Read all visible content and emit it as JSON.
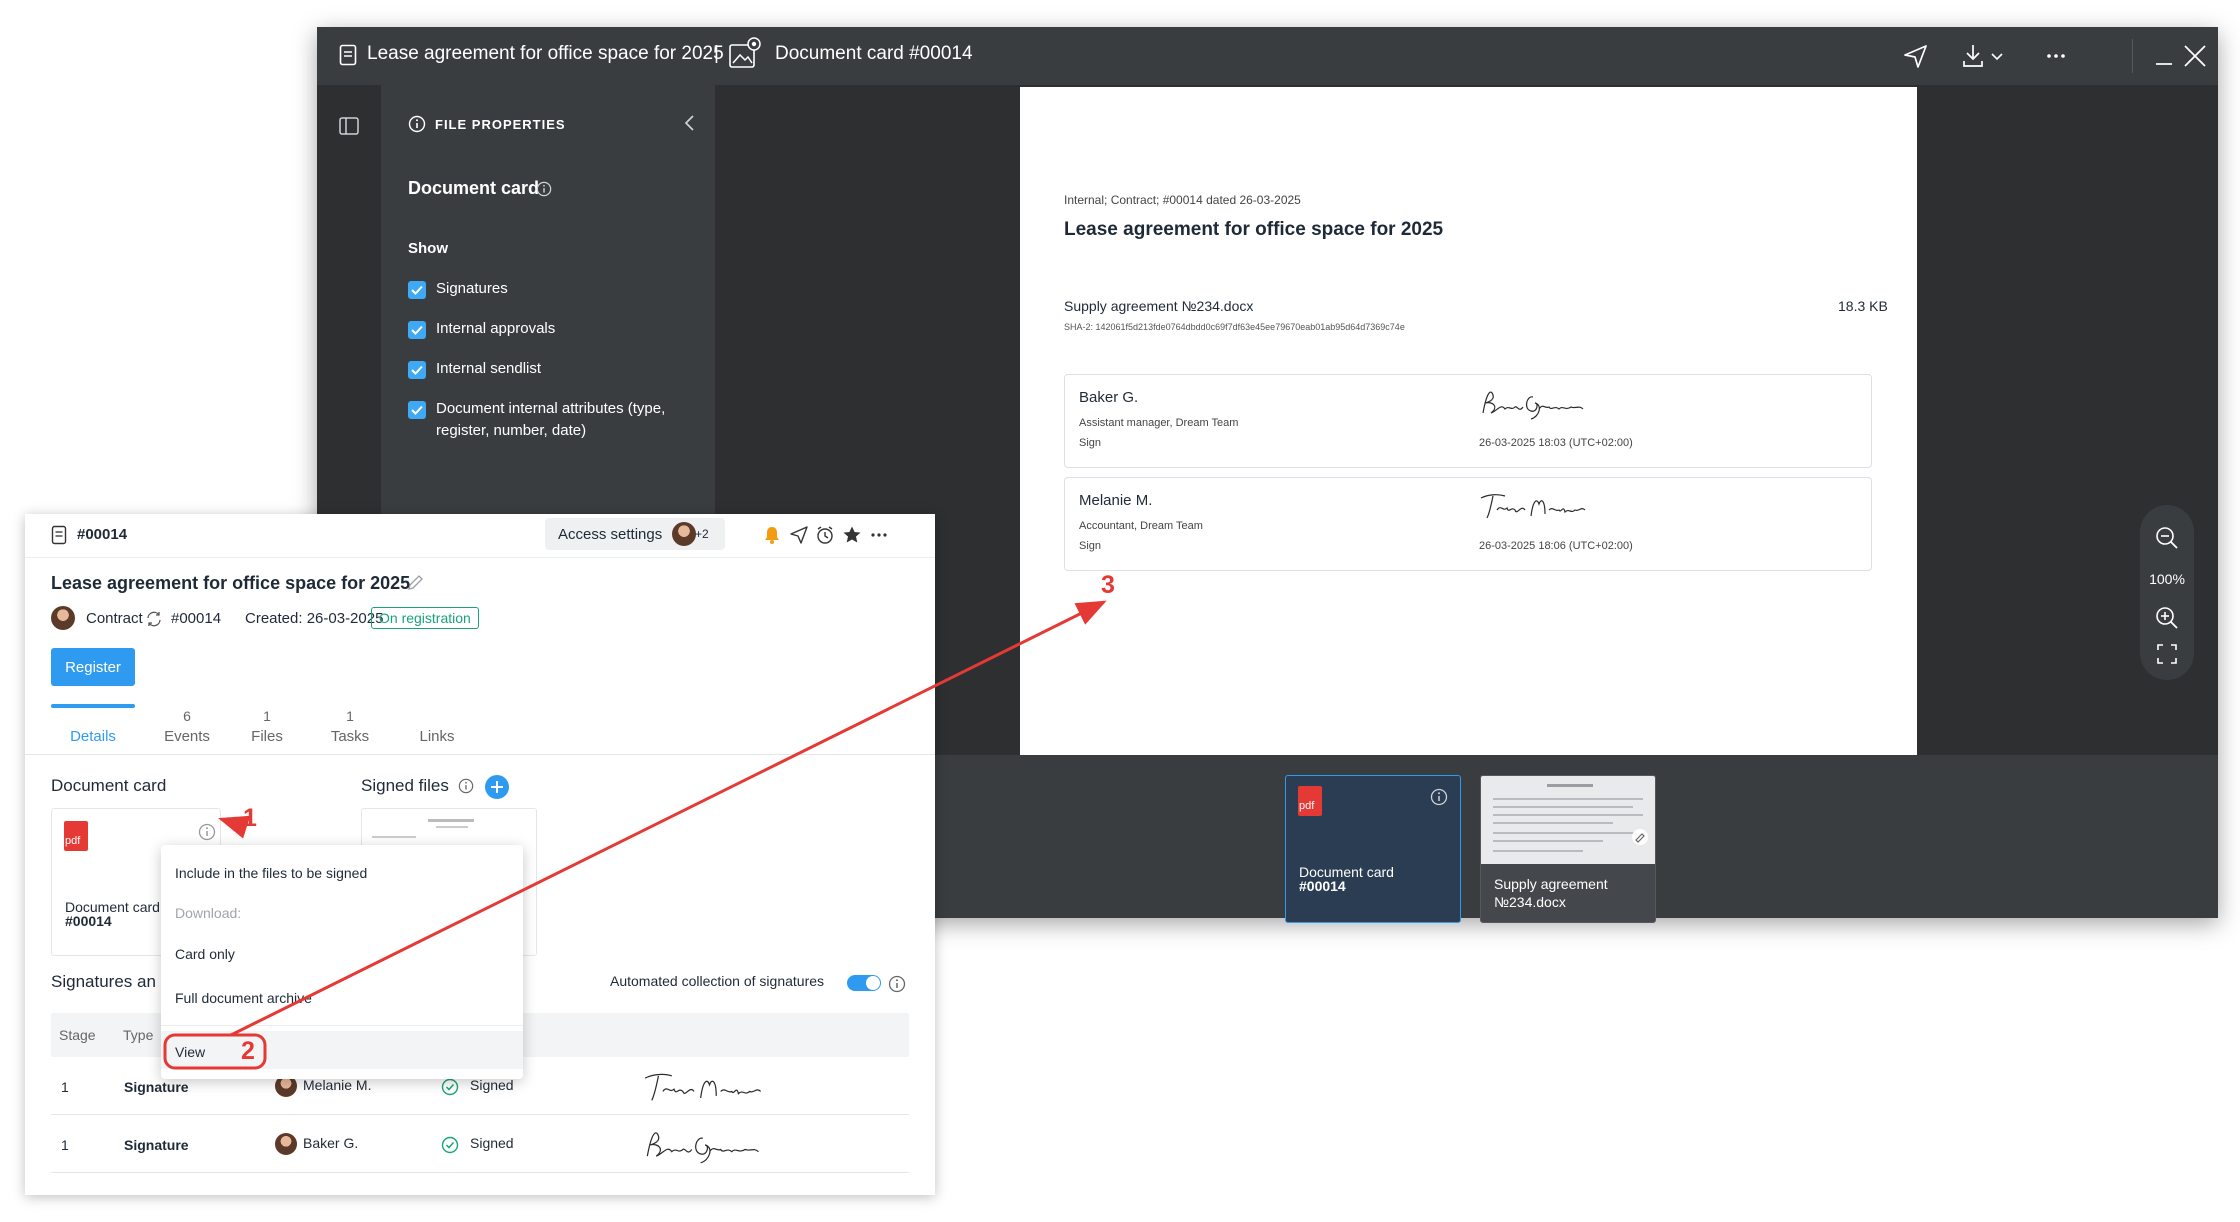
{
  "viewer": {
    "title": "Lease agreement for office space for 2025",
    "separator": "|",
    "subtitle": "Document card #00014",
    "properties": {
      "header": "FILE PROPERTIES",
      "card_title": "Document card",
      "show_label": "Show",
      "options": [
        {
          "label": "Signatures",
          "checked": true
        },
        {
          "label": "Internal approvals",
          "checked": true
        },
        {
          "label": "Internal sendlist",
          "checked": true
        },
        {
          "label": "Document internal attributes (type, register, number, date)",
          "checked": true
        }
      ]
    },
    "document": {
      "meta": "Internal; Contract; #00014 dated 26-03-2025",
      "title": "Lease agreement for office space for 2025",
      "file_name": "Supply agreement №234.docx",
      "file_size": "18.3 KB",
      "hash": "SHA-2: 142061f5d213fde0764dbdd0c69f7df63e45ee79670eab01ab95d64d7369c74e",
      "signers": [
        {
          "name": "Baker G.",
          "role": "Assistant manager, Dream Team",
          "action": "Sign",
          "signature": "Baker Grace",
          "datetime": "26-03-2025 18:03 (UTC+02:00)"
        },
        {
          "name": "Melanie M.",
          "role": "Accountant, Dream Team",
          "action": "Sign",
          "signature": "Taylor Melanie",
          "datetime": "26-03-2025 18:06 (UTC+02:00)"
        }
      ]
    },
    "zoom": "100%",
    "thumbnails": [
      {
        "line1": "Document card",
        "line2": "#00014",
        "badge": "pdf"
      },
      {
        "line1": "Supply agreement",
        "line2": "№234.docx"
      }
    ]
  },
  "card": {
    "number": "#00014",
    "access_settings": "Access settings",
    "access_more": "+2",
    "title": "Lease agreement for office space for 2025",
    "doc_type": "Contract",
    "doc_number": "#00014",
    "created": "Created: 26-03-2025",
    "status": "On registration",
    "register_button": "Register",
    "tabs": [
      {
        "label": "Details",
        "count": ""
      },
      {
        "label": "Events",
        "count": "6"
      },
      {
        "label": "Files",
        "count": "1"
      },
      {
        "label": "Tasks",
        "count": "1"
      },
      {
        "label": "Links",
        "count": ""
      }
    ],
    "document_card_heading": "Document card",
    "signed_files_heading": "Signed files",
    "tile_badge": "pdf",
    "tile_line1": "Document card",
    "tile_line2": "#00014",
    "signatures_heading": "Signatures an",
    "auto_collection": "Automated collection of signatures",
    "table_headers": [
      "Stage",
      "Type"
    ],
    "rows": [
      {
        "stage": "1",
        "type": "Signature",
        "person": "Melanie M.",
        "status": "Signed",
        "signature": "Taylor Melanie"
      },
      {
        "stage": "1",
        "type": "Signature",
        "person": "Baker G.",
        "status": "Signed",
        "signature": "Baker Grace"
      }
    ],
    "menu": {
      "include": "Include in the files to be signed",
      "download_label": "Download:",
      "card_only": "Card only",
      "full_archive": "Full document archive",
      "view": "View"
    }
  },
  "annotations": {
    "one": "1",
    "two": "2",
    "three": "3"
  },
  "colors": {
    "accent": "#2f9bf0",
    "viewer_bg": "#2d2f31",
    "viewer_bar": "#3a3d40",
    "status_green": "#1aa37a",
    "annotation": "#e53935",
    "pdf_red": "#e53935"
  }
}
